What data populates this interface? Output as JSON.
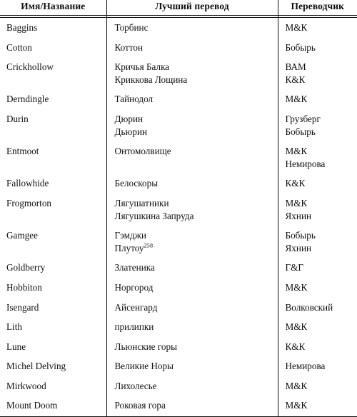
{
  "table": {
    "columns": [
      "Имя/Название",
      "Лучший перевод",
      "Переводчик"
    ],
    "rows": [
      {
        "name": "Baggins",
        "translations": [
          "Торбинс"
        ],
        "translators": [
          "М&К"
        ]
      },
      {
        "name": "Cotton",
        "translations": [
          "Коттон"
        ],
        "translators": [
          "Бобырь"
        ]
      },
      {
        "name": "Crickhollow",
        "translations": [
          "Кричья Балка",
          "Криккова Лощина"
        ],
        "translators": [
          "ВАМ",
          "К&К"
        ]
      },
      {
        "name": "Derndingle",
        "translations": [
          "Тайнодол"
        ],
        "translators": [
          "М&К"
        ]
      },
      {
        "name": "Durin",
        "translations": [
          "Дюрин",
          "Дьюрин"
        ],
        "translators": [
          "Грузберг",
          "Бобырь"
        ]
      },
      {
        "name": "Entmoot",
        "translations": [
          "Онтомолвище"
        ],
        "translators": [
          "М&К",
          "Немирова"
        ]
      },
      {
        "name": "Fallowhide",
        "translations": [
          "Белоскоры"
        ],
        "translators": [
          "К&К"
        ]
      },
      {
        "name": "Frogmorton",
        "translations": [
          "Лягушатники",
          "Лягушкина Запруда"
        ],
        "translators": [
          "М&К",
          "Яхнин"
        ]
      },
      {
        "name": "Gamgee",
        "translations": [
          "Гэмджи",
          "Плутоу"
        ],
        "translators": [
          "Бобырь",
          "Яхнин"
        ],
        "footnote": "258",
        "footnote_line": 1
      },
      {
        "name": "Goldberry",
        "translations": [
          "Златеника"
        ],
        "translators": [
          "Г&Г"
        ]
      },
      {
        "name": "Hobbiton",
        "translations": [
          "Норгород"
        ],
        "translators": [
          "М&К"
        ]
      },
      {
        "name": "Isengard",
        "translations": [
          "Айсенгард"
        ],
        "translators": [
          "Волковский"
        ]
      },
      {
        "name": "Lith",
        "translations": [
          "прилипки"
        ],
        "translators": [
          "М&К"
        ]
      },
      {
        "name": "Lune",
        "translations": [
          "Льюнские горы"
        ],
        "translators": [
          "К&К"
        ]
      },
      {
        "name": "Michel Delving",
        "translations": [
          "Великие Норы"
        ],
        "translators": [
          "Немирова"
        ]
      },
      {
        "name": "Mirkwood",
        "translations": [
          "Лихолесье"
        ],
        "translators": [
          "М&К"
        ]
      },
      {
        "name": "Mount Doom",
        "translations": [
          "Роковая гора"
        ],
        "translators": [
          "М&К"
        ]
      }
    ]
  },
  "style": {
    "rule_color": "#10100f",
    "text_color": "#10100f",
    "background": "#ffffff"
  }
}
